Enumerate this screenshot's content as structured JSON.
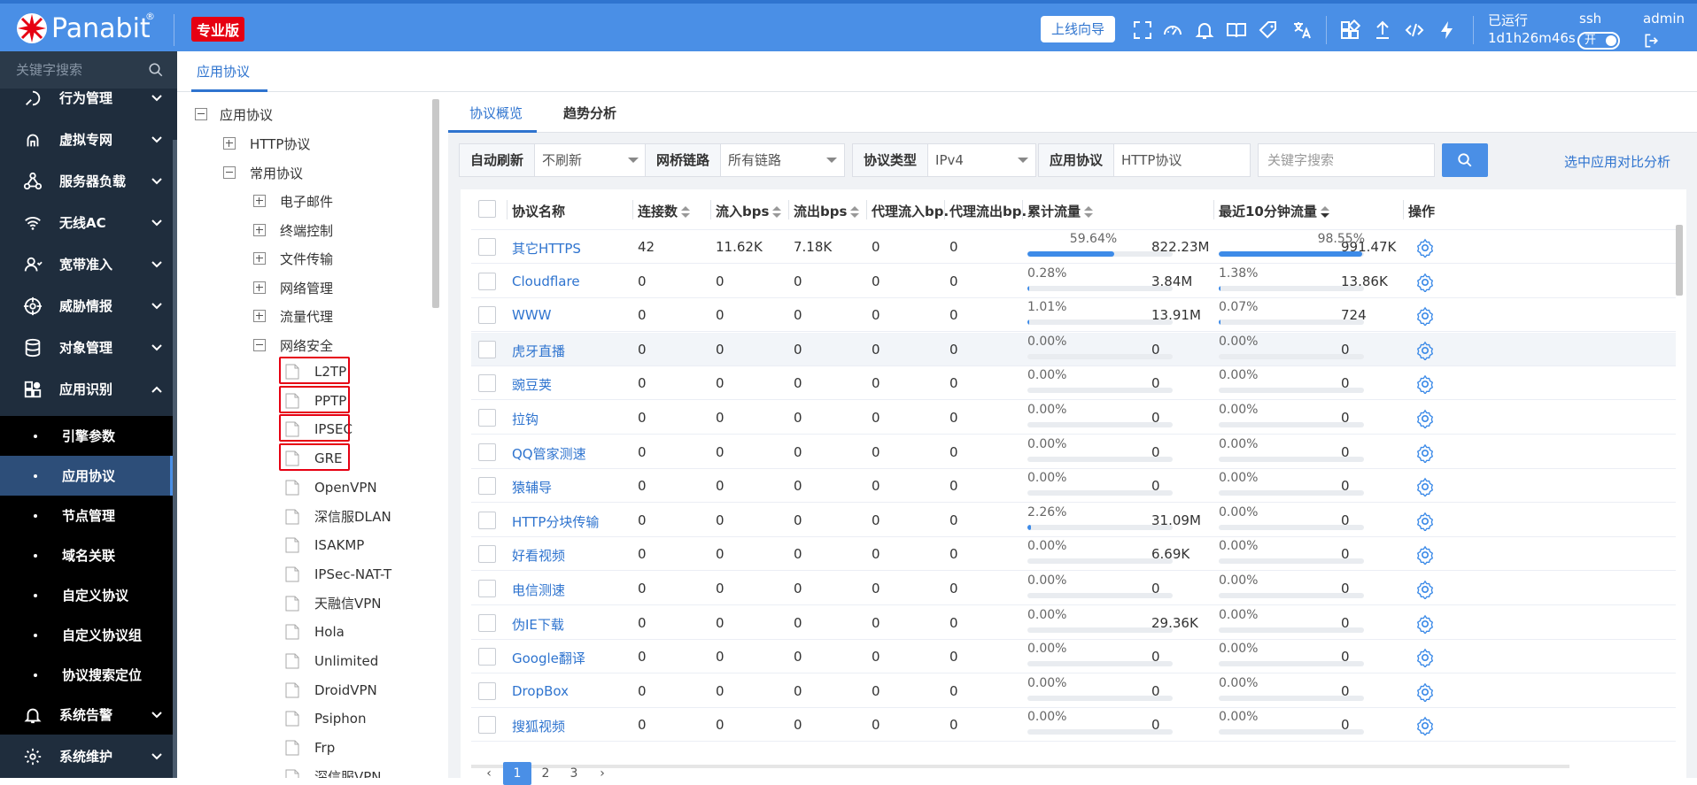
{
  "header": {
    "logo_text": "Panabit",
    "reg_mark": "®",
    "edition_badge": "专业版",
    "guide_button": "上线向导",
    "icons": [
      "fullscreen-icon",
      "dashboard-icon",
      "bell-icon",
      "book-icon",
      "tag-icon",
      "translate-icon",
      "apps-icon",
      "upload-icon",
      "code-icon",
      "flash-icon"
    ],
    "run_label": "已运行",
    "run_time": "1d1h26m46s",
    "ssh_label": "ssh",
    "ssh_toggle": "开",
    "user": "admin"
  },
  "sidebar": {
    "search_placeholder": "关键字搜索",
    "menu": [
      {
        "label": "行为管理",
        "icon": "behavior-icon"
      },
      {
        "label": "虚拟专网",
        "icon": "vpn-icon"
      },
      {
        "label": "服务器负载",
        "icon": "server-load-icon"
      },
      {
        "label": "无线AC",
        "icon": "wifi-icon"
      },
      {
        "label": "宽带准入",
        "icon": "user-access-icon"
      },
      {
        "label": "威胁情报",
        "icon": "threat-icon"
      },
      {
        "label": "对象管理",
        "icon": "database-icon"
      },
      {
        "label": "应用识别",
        "icon": "app-recognize-icon"
      }
    ],
    "submenu": [
      "引擎参数",
      "应用协议",
      "节点管理",
      "域名关联",
      "自定义协议",
      "自定义协议组",
      "协议搜索定位"
    ],
    "submenu_active": "应用协议",
    "bottom_menu": [
      {
        "label": "系统告警",
        "icon": "alarm-icon"
      },
      {
        "label": "系统维护",
        "icon": "settings-icon"
      }
    ]
  },
  "tabbar": {
    "active_tab": "应用协议"
  },
  "tree": {
    "root": "应用协议",
    "http": "HTTP协议",
    "common": "常用协议",
    "groups": [
      "电子邮件",
      "终端控制",
      "文件传输",
      "网络管理",
      "流量代理"
    ],
    "security": "网络安全",
    "leaves": [
      "L2TP",
      "PPTP",
      "IPSEC",
      "GRE",
      "OpenVPN",
      "深信服DLAN",
      "ISAKMP",
      "IPSec-NAT-T",
      "天融信VPN",
      "Hola",
      "Unlimited",
      "DroidVPN",
      "Psiphon",
      "Frp",
      "深信服VPN"
    ]
  },
  "panel": {
    "tabs": [
      "协议概览",
      "趋势分析"
    ],
    "filters": [
      {
        "label": "自动刷新",
        "value": "不刷新"
      },
      {
        "label": "网桥链路",
        "value": "所有链路"
      },
      {
        "label": "协议类型",
        "value": "IPv4"
      },
      {
        "label": "应用协议",
        "value": "HTTP协议"
      }
    ],
    "keyword_placeholder": "关键字搜索",
    "compare_link": "选中应用对比分析",
    "columns": [
      "协议名称",
      "连接数",
      "流入bps",
      "流出bps",
      "代理流入bp...",
      "代理流出bp...",
      "累计流量",
      "最近10分钟流量",
      "操作"
    ],
    "rows": [
      {
        "name": "其它HTTPS",
        "conn": "42",
        "in": "11.62K",
        "out": "7.18K",
        "pin": "0",
        "pout": "0",
        "tot_pct": "59.64%",
        "tot_frac": 0.5964,
        "tot": "822.23M",
        "r10_pct": "98.55%",
        "r10_frac": 0.9855,
        "r10": "991.47K"
      },
      {
        "name": "Cloudflare",
        "conn": "0",
        "in": "0",
        "out": "0",
        "pin": "0",
        "pout": "0",
        "tot_pct": "0.28%",
        "tot_frac": 0.0028,
        "tot": "3.84M",
        "r10_pct": "1.38%",
        "r10_frac": 0.0138,
        "r10": "13.86K"
      },
      {
        "name": "WWW",
        "conn": "0",
        "in": "0",
        "out": "0",
        "pin": "0",
        "pout": "0",
        "tot_pct": "1.01%",
        "tot_frac": 0.0101,
        "tot": "13.91M",
        "r10_pct": "0.07%",
        "r10_frac": 0.0007,
        "r10": "724"
      },
      {
        "name": "虎牙直播",
        "conn": "0",
        "in": "0",
        "out": "0",
        "pin": "0",
        "pout": "0",
        "tot_pct": "0.00%",
        "tot_frac": 0,
        "tot": "0",
        "r10_pct": "0.00%",
        "r10_frac": 0,
        "r10": "0"
      },
      {
        "name": "豌豆荚",
        "conn": "0",
        "in": "0",
        "out": "0",
        "pin": "0",
        "pout": "0",
        "tot_pct": "0.00%",
        "tot_frac": 0,
        "tot": "0",
        "r10_pct": "0.00%",
        "r10_frac": 0,
        "r10": "0"
      },
      {
        "name": "拉钩",
        "conn": "0",
        "in": "0",
        "out": "0",
        "pin": "0",
        "pout": "0",
        "tot_pct": "0.00%",
        "tot_frac": 0,
        "tot": "0",
        "r10_pct": "0.00%",
        "r10_frac": 0,
        "r10": "0"
      },
      {
        "name": "QQ管家测速",
        "conn": "0",
        "in": "0",
        "out": "0",
        "pin": "0",
        "pout": "0",
        "tot_pct": "0.00%",
        "tot_frac": 0,
        "tot": "0",
        "r10_pct": "0.00%",
        "r10_frac": 0,
        "r10": "0"
      },
      {
        "name": "猿辅导",
        "conn": "0",
        "in": "0",
        "out": "0",
        "pin": "0",
        "pout": "0",
        "tot_pct": "0.00%",
        "tot_frac": 0,
        "tot": "0",
        "r10_pct": "0.00%",
        "r10_frac": 0,
        "r10": "0"
      },
      {
        "name": "HTTP分块传输",
        "conn": "0",
        "in": "0",
        "out": "0",
        "pin": "0",
        "pout": "0",
        "tot_pct": "2.26%",
        "tot_frac": 0.0226,
        "tot": "31.09M",
        "r10_pct": "0.00%",
        "r10_frac": 0,
        "r10": "0"
      },
      {
        "name": "好看视频",
        "conn": "0",
        "in": "0",
        "out": "0",
        "pin": "0",
        "pout": "0",
        "tot_pct": "0.00%",
        "tot_frac": 0,
        "tot": "6.69K",
        "r10_pct": "0.00%",
        "r10_frac": 0,
        "r10": "0"
      },
      {
        "name": "电信测速",
        "conn": "0",
        "in": "0",
        "out": "0",
        "pin": "0",
        "pout": "0",
        "tot_pct": "0.00%",
        "tot_frac": 0,
        "tot": "0",
        "r10_pct": "0.00%",
        "r10_frac": 0,
        "r10": "0"
      },
      {
        "name": "伪IE下载",
        "conn": "0",
        "in": "0",
        "out": "0",
        "pin": "0",
        "pout": "0",
        "tot_pct": "0.00%",
        "tot_frac": 0,
        "tot": "29.36K",
        "r10_pct": "0.00%",
        "r10_frac": 0,
        "r10": "0"
      },
      {
        "name": "Google翻译",
        "conn": "0",
        "in": "0",
        "out": "0",
        "pin": "0",
        "pout": "0",
        "tot_pct": "0.00%",
        "tot_frac": 0,
        "tot": "0",
        "r10_pct": "0.00%",
        "r10_frac": 0,
        "r10": "0"
      },
      {
        "name": "DropBox",
        "conn": "0",
        "in": "0",
        "out": "0",
        "pin": "0",
        "pout": "0",
        "tot_pct": "0.00%",
        "tot_frac": 0,
        "tot": "0",
        "r10_pct": "0.00%",
        "r10_frac": 0,
        "r10": "0"
      },
      {
        "name": "搜狐视频",
        "conn": "0",
        "in": "0",
        "out": "0",
        "pin": "0",
        "pout": "0",
        "tot_pct": "0.00%",
        "tot_frac": 0,
        "tot": "0",
        "r10_pct": "0.00%",
        "r10_frac": 0,
        "r10": "0"
      }
    ],
    "pager": {
      "pages": [
        "1",
        "2",
        "3"
      ],
      "current": "1"
    }
  },
  "colors": {
    "brand": "#4a8fe6",
    "sidebar": "#1f2d3d",
    "highlight": "#e60012",
    "link": "#2f74cf"
  }
}
